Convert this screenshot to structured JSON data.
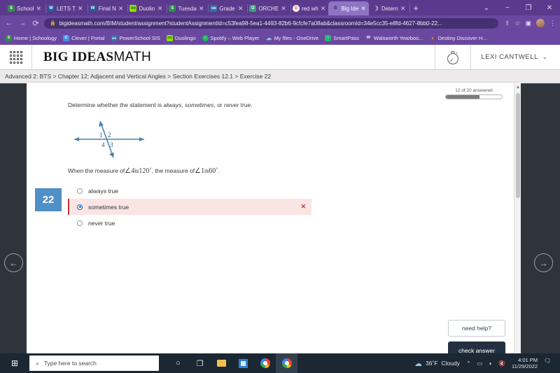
{
  "browser": {
    "tabs": [
      {
        "title": "School",
        "favicon": "schoology-icon",
        "color": "#2f8a4c",
        "glyph": "S",
        "active": false
      },
      {
        "title": "LETS T",
        "favicon": "word-doc-icon",
        "color": "#2b579a",
        "glyph": "W",
        "active": false
      },
      {
        "title": "Final N",
        "favicon": "word-doc-icon",
        "color": "#2b579a",
        "glyph": "W",
        "active": false
      },
      {
        "title": "Duolin",
        "favicon": "duolingo-icon",
        "color": "#8ee000",
        "glyph": "oo",
        "active": false
      },
      {
        "title": "Tuesda",
        "favicon": "schoology-icon",
        "color": "#2f8a4c",
        "glyph": "S",
        "active": false
      },
      {
        "title": "Grade",
        "favicon": "sis-icon",
        "color": "#3a6ea5",
        "glyph": "sis",
        "active": false
      },
      {
        "title": "ORCHE",
        "favicon": "teams-icon",
        "color": "#3b9c7e",
        "glyph": "O",
        "active": false
      },
      {
        "title": "red wh",
        "favicon": "google-icon",
        "color": "#ffffff",
        "glyph": "G",
        "active": false
      },
      {
        "title": "Big Ide",
        "favicon": "bigideas-icon",
        "color": "#6a48a0",
        "glyph": "B",
        "active": true
      },
      {
        "title": "Detern",
        "favicon": "moon-icon",
        "color": "#6a48a0",
        "glyph": ")",
        "active": false
      }
    ],
    "new_tab_label": "+",
    "window_controls": [
      "⌄",
      "−",
      "❐",
      "✕"
    ],
    "nav": {
      "back": "←",
      "forward": "→",
      "reload": "⟳"
    },
    "url": "bigideasmath.com/BIM/student/assignment?studentAssignmentId=c53fea98-5ea1-4493-82b6-9cfcfe7a08ab&classroomId=34e5cc35-e8fd-4627-8bb0-22...",
    "lock_icon": "lock-icon",
    "address_icons": [
      "share-icon",
      "star-icon",
      "extensions-icon",
      "profile-avatar",
      "menu-icon"
    ],
    "bookmarks": [
      {
        "label": "Home | Schoology",
        "glyph": "S",
        "color": "#2f8a4c"
      },
      {
        "label": "Clever | Portal",
        "glyph": "C",
        "color": "#4b8fe8"
      },
      {
        "label": "PowerSchool SIS",
        "glyph": "sis",
        "color": "#3a6ea5"
      },
      {
        "label": "Duolingo",
        "glyph": "oo",
        "color": "#8ee000"
      },
      {
        "label": "Spotify – Web Player",
        "glyph": "♫",
        "color": "#1db954"
      },
      {
        "label": "My files - OneDrive",
        "glyph": "☁",
        "color": "#5aa7e0"
      },
      {
        "label": "SmartPass",
        "glyph": "›",
        "color": "#29b473"
      },
      {
        "label": "Walsworth Yearboo...",
        "glyph": "W",
        "color": "#ffffff"
      },
      {
        "label": "Destiny Discover H...",
        "glyph": "◗",
        "color": "#f0a020"
      }
    ]
  },
  "app": {
    "logo_bold": "BIG IDEAS",
    "logo_thin": "MATH",
    "waffle_icon": "apps-grid-icon",
    "timer_icon": "stopwatch-icon",
    "user_name": "LEXI CANTWELL",
    "user_caret": "⌄",
    "breadcrumb": "Advanced 2: BTS > Chapter 12: Adjacent and Vertical Angles > Section Exercises 12.1 > Exercise 22"
  },
  "exercise": {
    "progress_label": "12 of 20 answered",
    "progress_answered": 12,
    "progress_total": 20,
    "progress_percent": 60,
    "number_badge": "22",
    "prompt_pre": "Determine whether the statement is ",
    "prompt_em1": "always",
    "prompt_mid1": ", ",
    "prompt_em2": "sometimes",
    "prompt_mid2": ", or ",
    "prompt_em3": "never",
    "prompt_post": " true.",
    "statement_part1": "When the measure of ",
    "statement_angle1": "∠4",
    "statement_part2": " is ",
    "statement_value1": "120˚",
    "statement_part3": ", the measure of ",
    "statement_angle2": "∠1",
    "statement_part4": " is ",
    "statement_value2": "60˚",
    "statement_part5": ".",
    "figure": {
      "name": "intersecting-lines-angles-diagram",
      "angle_labels": [
        "1",
        "2",
        "4",
        "3"
      ],
      "line_color": "#4b82a8"
    },
    "options": [
      {
        "label": "always true",
        "selected": false,
        "state": "none"
      },
      {
        "label": "sometimes true",
        "selected": true,
        "state": "incorrect"
      },
      {
        "label": "never true",
        "selected": false,
        "state": "none"
      }
    ],
    "incorrect_mark": "✕",
    "help_button": "need help?",
    "check_button": "check answer",
    "prev_arrow": "←",
    "next_arrow": "→"
  },
  "taskbar": {
    "start_icon": "windows-start-icon",
    "search_placeholder": "Type here to search",
    "search_icon": "search-icon",
    "icons": [
      {
        "name": "cortana-icon",
        "glyph": "○"
      },
      {
        "name": "task-view-icon",
        "glyph": "⧉"
      },
      {
        "name": "file-explorer-icon",
        "glyph": "folder"
      },
      {
        "name": "outlook-icon",
        "glyph": "square"
      },
      {
        "name": "chrome-icon",
        "glyph": "chrome"
      },
      {
        "name": "chrome-active-icon",
        "glyph": "chrome"
      }
    ],
    "weather_icon": "cloud-icon",
    "weather_temp": "36˚F",
    "weather_desc": "Cloudy",
    "tray_icons": [
      "chevron-up-icon",
      "battery-icon",
      "wifi-icon",
      "volume-mute-icon"
    ],
    "time": "4:01 PM",
    "date": "11/29/2022",
    "notification_icon": "notification-icon",
    "notification_count": "1"
  }
}
